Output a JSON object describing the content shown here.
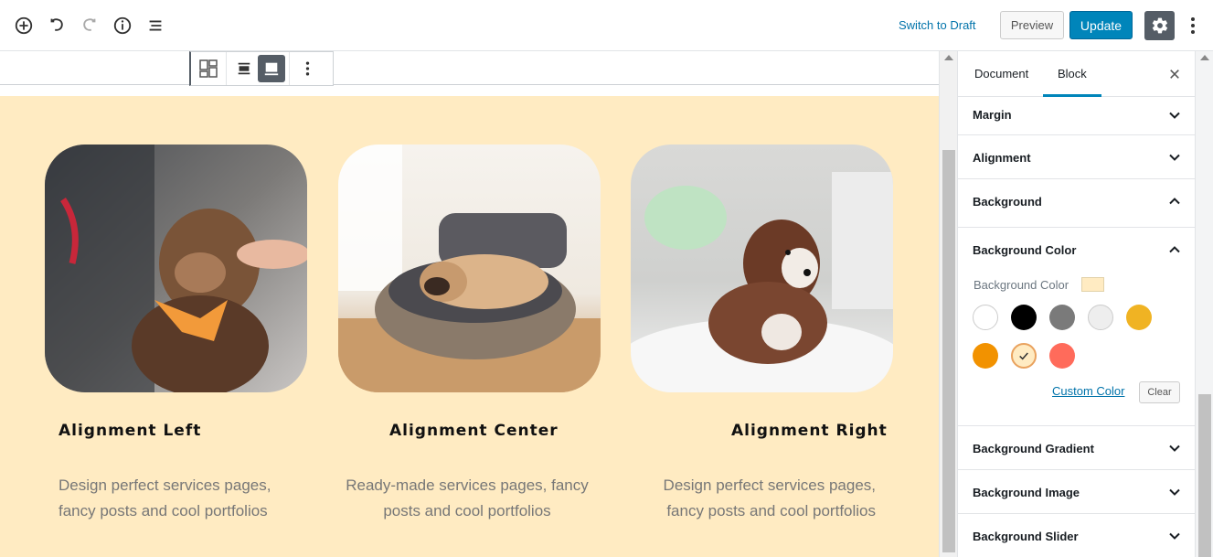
{
  "topbar": {
    "add_block_icon": "plus-circle-icon",
    "undo_icon": "undo-icon",
    "redo_icon": "redo-icon",
    "info_icon": "info-icon",
    "outline_icon": "list-icon",
    "switch_to_draft": "Switch to Draft",
    "preview": "Preview",
    "update": "Update",
    "settings_icon": "gear-icon",
    "more_icon": "more-vertical-icon"
  },
  "block_toolbar": {
    "buttons": [
      "block-layout-icon",
      "align-wide-icon",
      "align-full-icon",
      "more-vertical-icon"
    ]
  },
  "content": {
    "background_color": "#ffebc2",
    "cards": [
      {
        "title": "Alignment Left",
        "desc_line1": "Design perfect services pages,",
        "desc_line2": "fancy posts and cool portfolios",
        "image": "puppy being petted"
      },
      {
        "title": "Alignment Center",
        "desc_line1": "Ready-made services pages, fancy",
        "desc_line2": "posts and cool portfolios",
        "image": "pug in wicker basket"
      },
      {
        "title": "Alignment Right",
        "desc_line1": "Design perfect services pages,",
        "desc_line2": "fancy posts and cool portfolios",
        "image": "brown curly puppy on blanket"
      }
    ]
  },
  "sidebar": {
    "tabs": [
      "Document",
      "Block"
    ],
    "active_tab": "Block",
    "close_icon": "close-icon",
    "panels": {
      "margin": "Margin",
      "alignment": "Alignment",
      "background": "Background",
      "background_color": "Background Color",
      "background_gradient": "Background Gradient",
      "background_image": "Background Image",
      "background_slider": "Background Slider"
    },
    "bg_color_label": "Background Color",
    "swatches": [
      "#ffffff",
      "#000000",
      "#7a7a7a",
      "#eeeeee",
      "#f0b323",
      "#f29200",
      "#ffebc2",
      "#ff6b5b"
    ],
    "selected_swatch": "#ffebc2",
    "custom_color": "Custom Color",
    "clear": "Clear"
  }
}
